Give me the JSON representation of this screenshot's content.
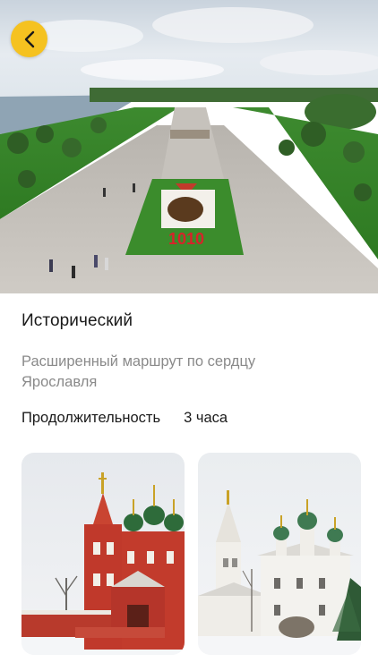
{
  "route": {
    "title": "Исторический",
    "description": "Расширенный маршрут по сердцу Ярославля",
    "duration_label": "Продолжительность",
    "duration_value": "3 часа"
  },
  "hero": {
    "flowerbed_text": "1010"
  },
  "gallery": {
    "photos": [
      {
        "icon": "church-red-photo"
      },
      {
        "icon": "church-white-photo"
      }
    ]
  },
  "colors": {
    "accent": "#f5c220",
    "title": "#1a1a1a",
    "secondary_text": "#8a8a8a",
    "background": "#ffffff"
  }
}
